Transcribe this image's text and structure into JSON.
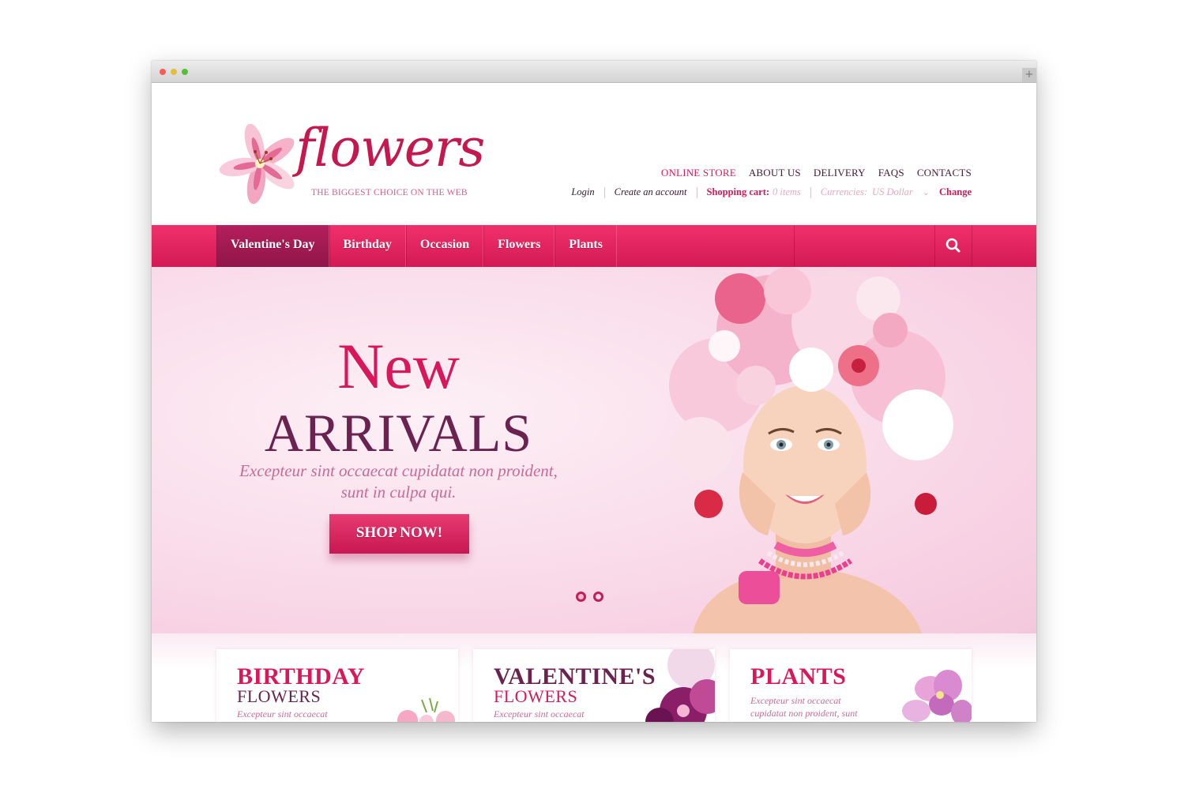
{
  "header": {
    "logo_word": "flowers",
    "logo_tagline": "THE BIGGEST CHOICE ON THE WEB",
    "top_nav": [
      "ONLINE STORE",
      "ABOUT US",
      "DELIVERY",
      "FAQS",
      "CONTACTS"
    ],
    "login": "Login",
    "create_account": "Create an account",
    "cart_label": "Shopping cart:",
    "cart_items": "0 items",
    "currencies_label": "Currencies:",
    "currency_value": "US Dollar",
    "change": "Change"
  },
  "menu": {
    "items": [
      "Valentine's Day",
      "Birthday",
      "Occasion",
      "Flowers",
      "Plants"
    ],
    "search_icon": "search-icon"
  },
  "hero": {
    "title_line1": "New",
    "title_line2": "ARRIVALS",
    "text_line1": "Excepteur sint occaecat cupidatat non proident,",
    "text_line2": "sunt in culpa qui.",
    "button": "SHOP NOW!",
    "slides": 2,
    "active_slide": 1
  },
  "cards": [
    {
      "title": "BIRTHDAY",
      "subtitle": "FLOWERS",
      "desc": "Excepteur sint occaecat"
    },
    {
      "title": "VALENTINE'S",
      "subtitle": "FLOWERS",
      "desc": "Excepteur sint occaecat"
    },
    {
      "title": "PLANTS",
      "desc_line1": "Excepteur sint occaecat",
      "desc_line2": "cupidatat non proident, sunt"
    }
  ],
  "colors": {
    "accent": "#d8185a",
    "dark_accent": "#6a2350",
    "menu_active": "#a11b53",
    "hero_bg": "#f8d4e5"
  }
}
